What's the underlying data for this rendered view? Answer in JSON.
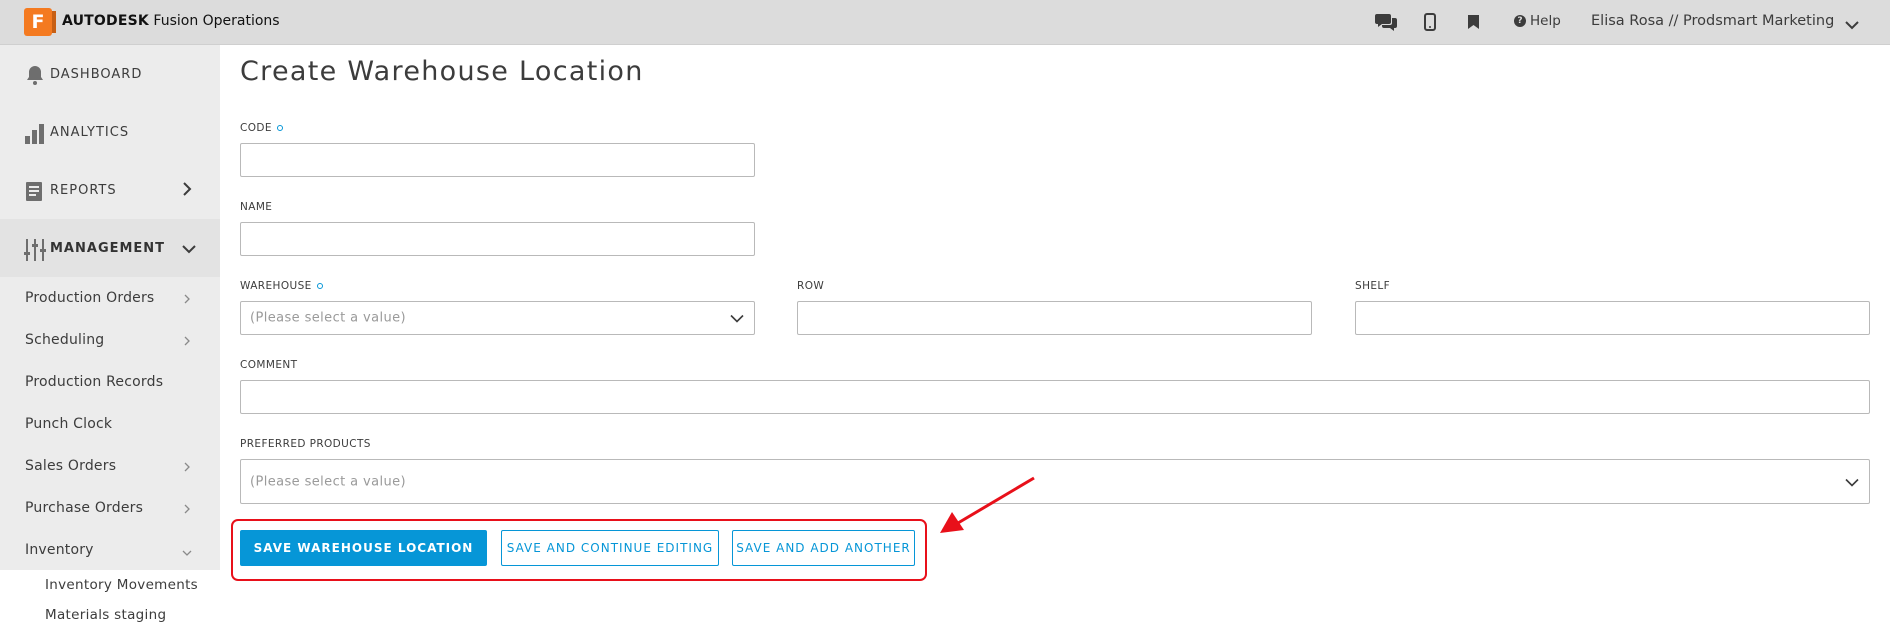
{
  "topbar": {
    "logo_letter": "F",
    "brand_bold": "AUTODESK",
    "brand_rest": " Fusion Operations",
    "help_label": "Help",
    "user_label": "Elisa Rosa // Prodsmart Marketing",
    "icons": [
      "chat-icon",
      "mobile-icon",
      "bookmark-icon",
      "help-icon",
      "chevron-down-icon"
    ]
  },
  "sidebar": {
    "main_items": [
      {
        "label": "DASHBOARD",
        "icon": "bell-icon"
      },
      {
        "label": "ANALYTICS",
        "icon": "bar-chart-icon"
      },
      {
        "label": "REPORTS",
        "icon": "report-icon"
      },
      {
        "label": "MANAGEMENT",
        "icon": "sliders-icon"
      }
    ],
    "sub_items": [
      {
        "label": "Production Orders",
        "chevron": "right"
      },
      {
        "label": "Scheduling",
        "chevron": "right"
      },
      {
        "label": "Production Records",
        "chevron": ""
      },
      {
        "label": "Punch Clock",
        "chevron": ""
      },
      {
        "label": "Sales Orders",
        "chevron": "right"
      },
      {
        "label": "Purchase Orders",
        "chevron": "right"
      },
      {
        "label": "Inventory",
        "chevron": "down"
      }
    ],
    "inventory_items": [
      "Inventory Movements",
      "Materials staging"
    ]
  },
  "form": {
    "title": "Create Warehouse Location",
    "code_label": "CODE",
    "code_value": "",
    "name_label": "NAME",
    "name_value": "",
    "warehouse_label": "WAREHOUSE",
    "warehouse_placeholder": "(Please select a value)",
    "row_label": "ROW",
    "row_value": "",
    "shelf_label": "SHELF",
    "shelf_value": "",
    "comment_label": "COMMENT",
    "comment_value": "",
    "preferred_label": "PREFERRED PRODUCTS",
    "preferred_placeholder": "(Please select a value)"
  },
  "actions": {
    "save": "SAVE WAREHOUSE LOCATION",
    "save_continue": "SAVE AND CONTINUE EDITING",
    "save_add": "SAVE AND ADD ANOTHER"
  },
  "colors": {
    "accent": "#0696d7",
    "brand_orange": "#f47a20",
    "annotation_red": "#e8101a",
    "topbar_bg": "#dcdcdc",
    "sidebar_bg": "#ececec"
  }
}
